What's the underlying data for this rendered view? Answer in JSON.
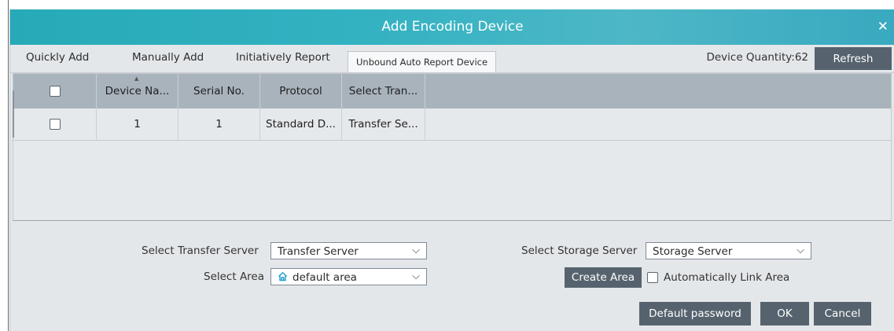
{
  "dialog": {
    "title": "Add Encoding Device",
    "close_glyph": "✕"
  },
  "tabs": [
    {
      "label": "Quickly Add"
    },
    {
      "label": "Manually Add"
    },
    {
      "label": "Initiatively Report"
    },
    {
      "label": "Unbound Auto Report Device",
      "active": true
    }
  ],
  "device_quantity": "Device Quantity:62",
  "refresh_label": "Refresh",
  "table": {
    "columns": [
      "Device Na...",
      "Serial No.",
      "Protocol",
      "Select Tran..."
    ],
    "rows": [
      {
        "device_name": "1",
        "serial_no": "1",
        "protocol": "Standard D...",
        "transfer": "Transfer Se..."
      }
    ]
  },
  "form": {
    "transfer_label": "Select Transfer Server",
    "transfer_value": "Transfer Server",
    "area_label": "Select Area",
    "area_value": "default area",
    "storage_label": "Select Storage Server",
    "storage_value": "Storage Server",
    "create_area_label": "Create Area",
    "auto_link_label": "Automatically Link Area"
  },
  "footer": {
    "default_password_label": "Default password",
    "ok_label": "OK",
    "cancel_label": "Cancel"
  },
  "icons": {
    "area_icon": "home-icon",
    "dropdown_icon": "chevron-down-icon"
  },
  "colors": {
    "title_bar": "#33b2c2",
    "button": "#56636e",
    "table_header": "#a9b3bb",
    "dialog_bg": "#e4e7ea",
    "home_icon": "#1d9bd1"
  }
}
